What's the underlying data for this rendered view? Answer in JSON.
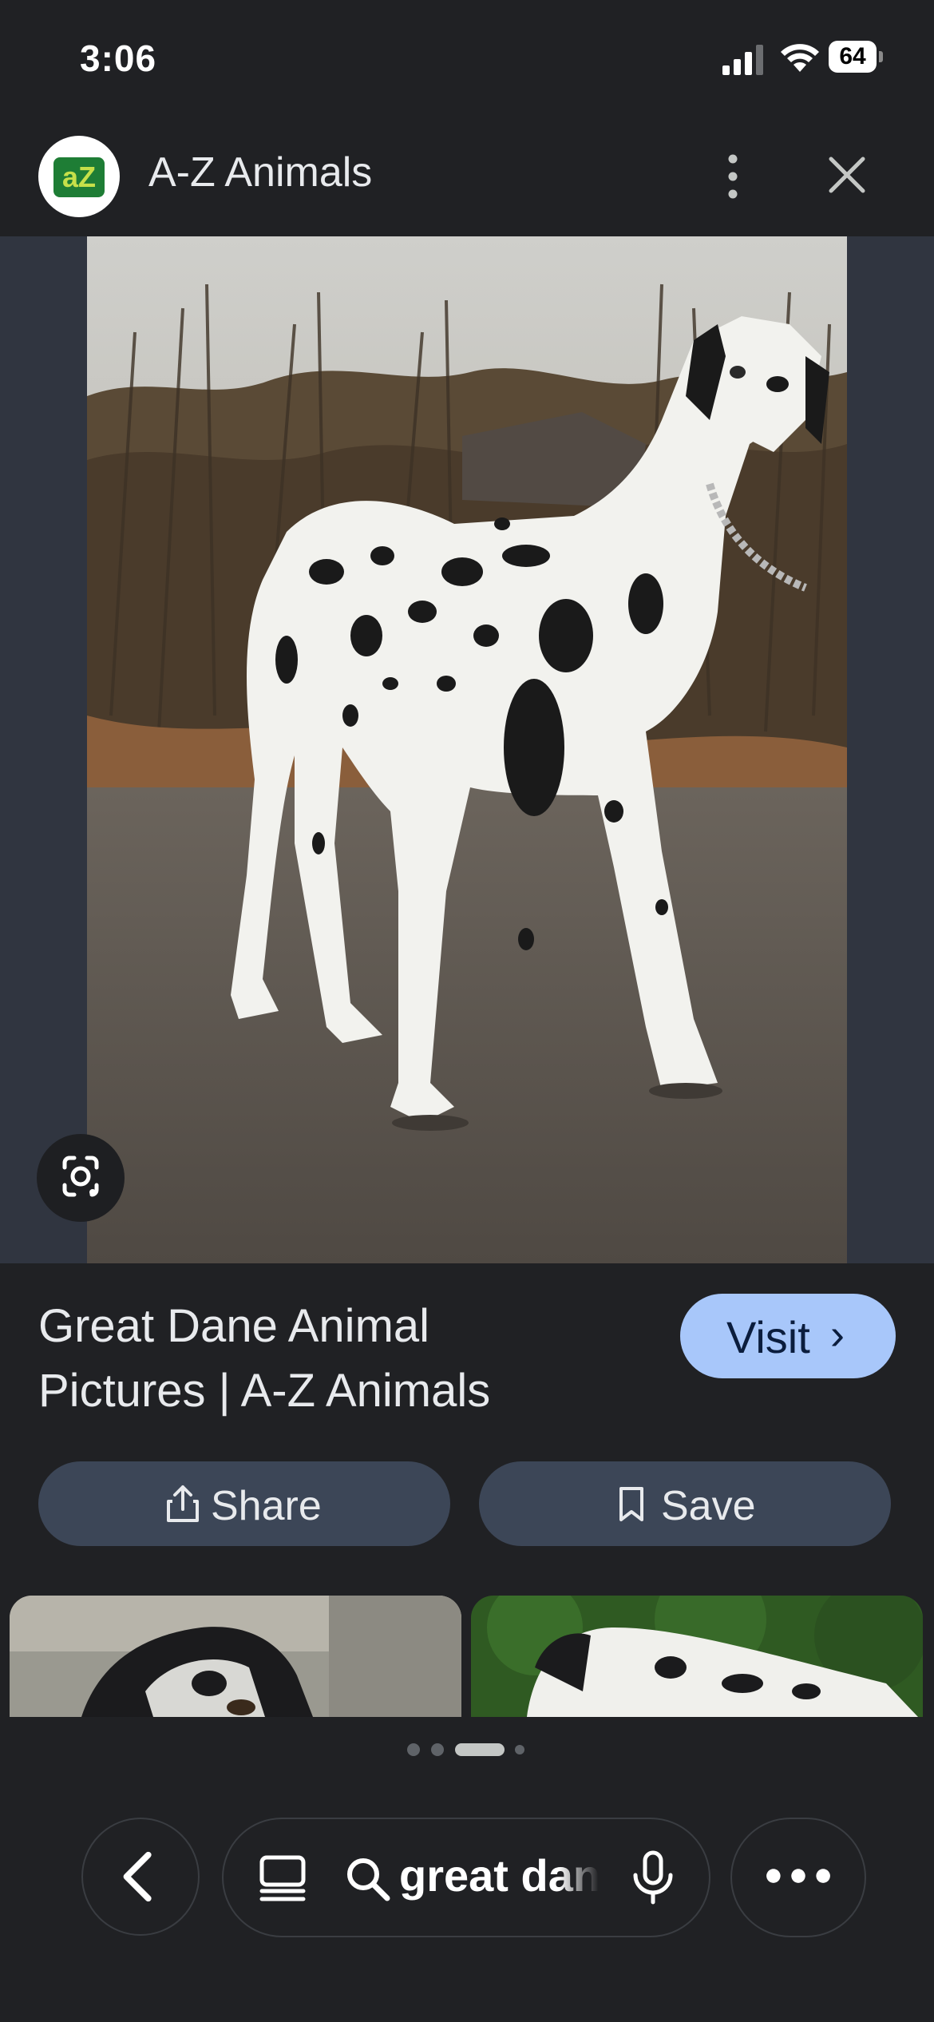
{
  "status_bar": {
    "time": "3:06",
    "battery": "64"
  },
  "header": {
    "site_name": "A-Z Animals",
    "logo_text": "aZ",
    "more_icon": "more-vert-icon",
    "close_icon": "close-icon"
  },
  "image": {
    "subject": "dog-photo",
    "lens_icon": "google-lens-icon"
  },
  "result": {
    "title": "Great Dane Animal Pictures | A-Z Animals",
    "visit_label": "Visit",
    "visit_chevron": "›"
  },
  "actions": {
    "share_label": "Share",
    "save_label": "Save"
  },
  "pager": {
    "count": 4,
    "active_index": 2
  },
  "bottom_bar": {
    "search_query": "great dane",
    "icons": [
      "back-icon",
      "tabs-icon",
      "search-icon",
      "mic-icon",
      "more-horiz-icon"
    ]
  },
  "colors": {
    "background": "#202124",
    "visit_button": "#a8c7fa",
    "pill_button": "#3c4657",
    "image_backdrop": "#303540"
  }
}
